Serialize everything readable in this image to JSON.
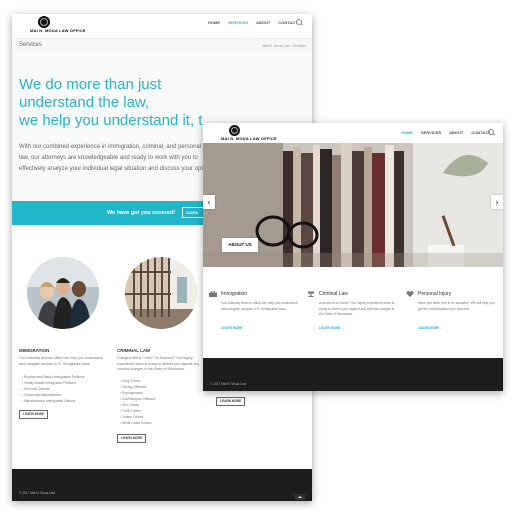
{
  "site": {
    "logo_text": "MAI N. MOUA LAW OFFICE"
  },
  "back_window": {
    "nav": {
      "home": "HOME",
      "services": "SERVICES",
      "about": "ABOUT",
      "contact": "CONTACT"
    },
    "page_title": "Services",
    "breadcrumb": "Mai N. Moua Law / Services",
    "headline_lines": [
      "We do more than just",
      "understand the law,",
      "we help you understand it, t"
    ],
    "intro_text": "With our combined experience in immigration, criminal, and personal injury law, our attorneys are knowledgeable and ready to work with you to effectively analyze your individual legal situation and discuss your options.",
    "cta_band": {
      "text": "We have got you covered!",
      "button": "CONTA"
    },
    "immigration": {
      "heading": "IMMIGRATION",
      "description": "Our culturally diverse office can help you understand and navigate complex U.S. immigration laws.",
      "items": [
        "Employment-Based Immigration Petitions",
        "Family-Based Immigration Petitions",
        "Removal Defense",
        "Citizenship/Naturalization",
        "Miscellaneous Immigration Options"
      ],
      "button": "LEARN MORE"
    },
    "criminal": {
      "heading": "CRIMINAL LAW",
      "description": "Charged with a Crime? Or Accused? Our highly experience team is ready to defend you against any criminal charges in the State of Minnesota.",
      "items": [
        "Drug Crimes",
        "Driving Offenses",
        "Expungement",
        "Gun/Weapon Offenses",
        "Sex Crimes",
        "Theft Crimes",
        "Violent Crimes",
        "White Collar Crimes"
      ],
      "button": "LEARN MORE"
    },
    "third_button": "LEARN MORE",
    "footer": "© 2017 Mai N. Moua Law"
  },
  "front_window": {
    "nav": {
      "home": "HOME",
      "services": "SERVICES",
      "about": "ABOUT",
      "contact": "CONTACT"
    },
    "slider_prev": "‹",
    "slider_next": "›",
    "about_button": "ABOUT US",
    "services": [
      {
        "title": "Immigration",
        "description": "Our culturally diverse office can help you understand and navigate complex U.S. immigration laws.",
        "link": "LEARN MORE →"
      },
      {
        "title": "Criminal Law",
        "description": "Accused of a Crime? Our highly experience team is ready to defend you against any criminal charges in the State of Minnesota.",
        "link": "LEARN MORE →"
      },
      {
        "title": "Personal Injury",
        "description": "Have you been hurt in an accident? We will help you get the compensation you deserve!",
        "link": "LEARN MORE →"
      }
    ],
    "footer": "© 2017 Mai N. Moua Law"
  },
  "colors": {
    "accent": "#2ab3c9",
    "band": "#21b7cb",
    "footer": "#1d1d1d"
  }
}
